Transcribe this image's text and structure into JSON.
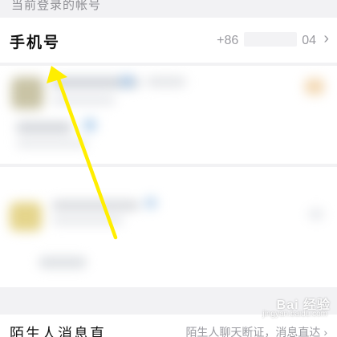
{
  "section_header": {
    "title": "当前登录的帐号"
  },
  "phone_row": {
    "label": "手机号",
    "value_prefix": "+86",
    "value_suffix": "04",
    "chevron": "›"
  },
  "bottom_row": {
    "label": "陌生人消息直",
    "value": "陌生人聊天断证，消息直达",
    "chevron": "›"
  },
  "icons": {
    "chevron": "chevron-right-icon",
    "arrow": "annotation-arrow-icon"
  },
  "watermark": {
    "text": "Bai 经验",
    "sub": "jingyan.baidu.com"
  },
  "colors": {
    "background": "#f2f2f4",
    "row": "#ffffff",
    "arrow": "#ffee00"
  }
}
